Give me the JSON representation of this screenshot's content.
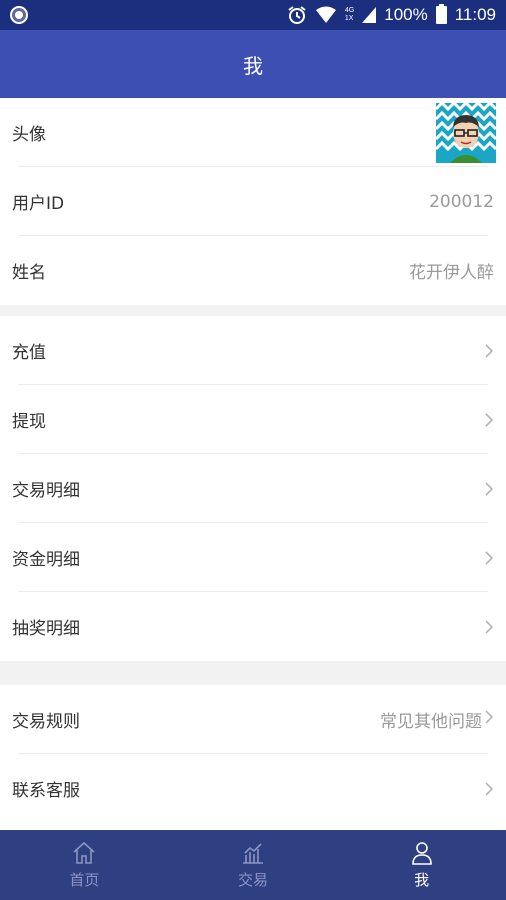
{
  "status_bar": {
    "net_top": "4G",
    "net_bottom": "1X",
    "battery": "100%",
    "time": "11:09"
  },
  "header": {
    "title": "我"
  },
  "profile": {
    "avatar_label": "头像",
    "user_id_label": "用户ID",
    "user_id_value": "200012",
    "name_label": "姓名",
    "name_value": "花开伊人醉"
  },
  "finance": {
    "items": [
      {
        "label": "充值"
      },
      {
        "label": "提现"
      },
      {
        "label": "交易明细"
      },
      {
        "label": "资金明细"
      },
      {
        "label": "抽奖明细"
      }
    ]
  },
  "help": {
    "rules_label": "交易规则",
    "rules_value": "常见其他问题",
    "service_label": "联系客服"
  },
  "tabbar": {
    "items": [
      {
        "label": "首页",
        "icon": "home-icon"
      },
      {
        "label": "交易",
        "icon": "chart-icon"
      },
      {
        "label": "我",
        "icon": "person-icon"
      }
    ],
    "active": "我"
  },
  "colors": {
    "header_bg": "#3d4fb3",
    "status_bg": "#1c2f7f",
    "tabbar_bg": "#2e3f82",
    "avatar_bg": "#1aa6c4"
  }
}
